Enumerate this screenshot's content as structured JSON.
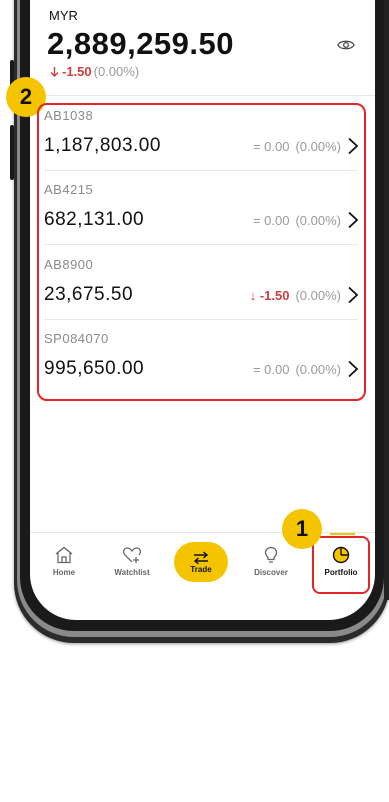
{
  "header": {
    "currency": "MYR",
    "total_value": "2,889,259.50",
    "change_value": "-1.50",
    "change_percent": "(0.00%)"
  },
  "badges": {
    "badge1": "1",
    "badge2": "2"
  },
  "accounts": [
    {
      "id": "AB1038",
      "value": "1,187,803.00",
      "change_prefix": "= ",
      "change_value": "0.00",
      "change_percent": "(0.00%)"
    },
    {
      "id": "AB4215",
      "value": "682,131.00",
      "change_prefix": "= ",
      "change_value": "0.00",
      "change_percent": "(0.00%)"
    },
    {
      "id": "AB8900",
      "value": "23,675.50",
      "change_prefix": "↓ ",
      "change_value": "-1.50",
      "change_percent": "(0.00%)"
    },
    {
      "id": "SP084070",
      "value": "995,650.00",
      "change_prefix": "= ",
      "change_value": "0.00",
      "change_percent": "(0.00%)"
    }
  ],
  "nav": {
    "home": "Home",
    "watchlist": "Watchlist",
    "trade": "Trade",
    "discover": "Discover",
    "portfolio": "Portfolio"
  },
  "colors": {
    "accent": "#f5c400",
    "highlight": "#e0262b",
    "negative": "#d23c3c"
  },
  "icons": [
    "eye-icon",
    "arrow-down-icon",
    "chevron-right-icon",
    "home-icon",
    "heart-plus-icon",
    "swap-icon",
    "lightbulb-icon",
    "pie-chart-icon"
  ]
}
